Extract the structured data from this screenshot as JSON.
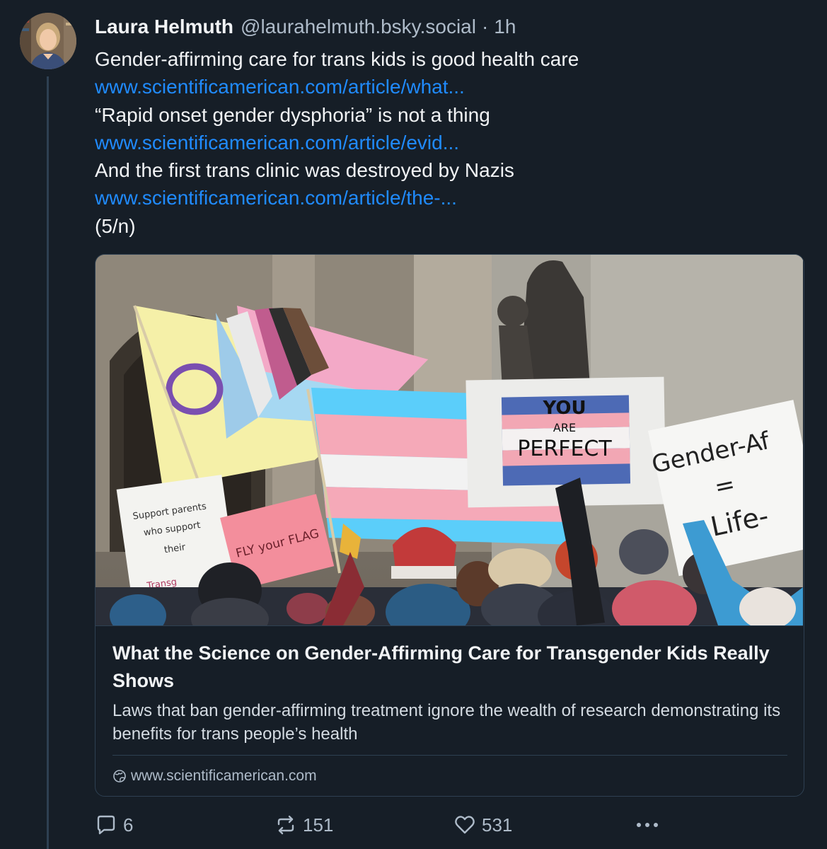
{
  "author": {
    "display_name": "Laura Helmuth",
    "handle": "@laurahelmuth.bsky.social",
    "separator": "·",
    "time": "1h"
  },
  "post_lines": [
    {
      "text": "Gender-affirming care for trans kids is good health care",
      "type": "text"
    },
    {
      "text": "www.scientificamerican.com/article/what...",
      "type": "link"
    },
    {
      "text": "“Rapid onset gender dysphoria” is not a thing",
      "type": "text"
    },
    {
      "text": "www.scientificamerican.com/article/evid...",
      "type": "link"
    },
    {
      "text": "And the first trans clinic was destroyed by Nazis",
      "type": "text"
    },
    {
      "text": "www.scientificamerican.com/article/the-...",
      "type": "link"
    },
    {
      "text": "(5/n)",
      "type": "text"
    }
  ],
  "link_card": {
    "image_signs": {
      "sign1_line1": "Support parents",
      "sign1_line2": "who support",
      "sign1_line3": "their",
      "sign1_line4": "Transg",
      "sign2_text": "FLY your FLAG",
      "sign3_line1": "YOU",
      "sign3_line2": "ARE",
      "sign3_line3": "PERFECT",
      "sign4_line1": "Gender-Af",
      "sign4_line2": "=",
      "sign4_line3": "Life-"
    },
    "title": "What the Science on Gender-Affirming Care for Transgender Kids Really Shows",
    "description": "Laws that ban gender-affirming treatment ignore the wealth of research demonstrating its benefits for trans people’s health",
    "domain": "www.scientificamerican.com"
  },
  "actions": {
    "reply_count": "6",
    "repost_count": "151",
    "like_count": "531",
    "more_icon": "ellipsis-icon"
  },
  "colors": {
    "background": "#161e27",
    "link": "#208bfe",
    "muted": "#aebbc9",
    "border": "#2e4052"
  }
}
